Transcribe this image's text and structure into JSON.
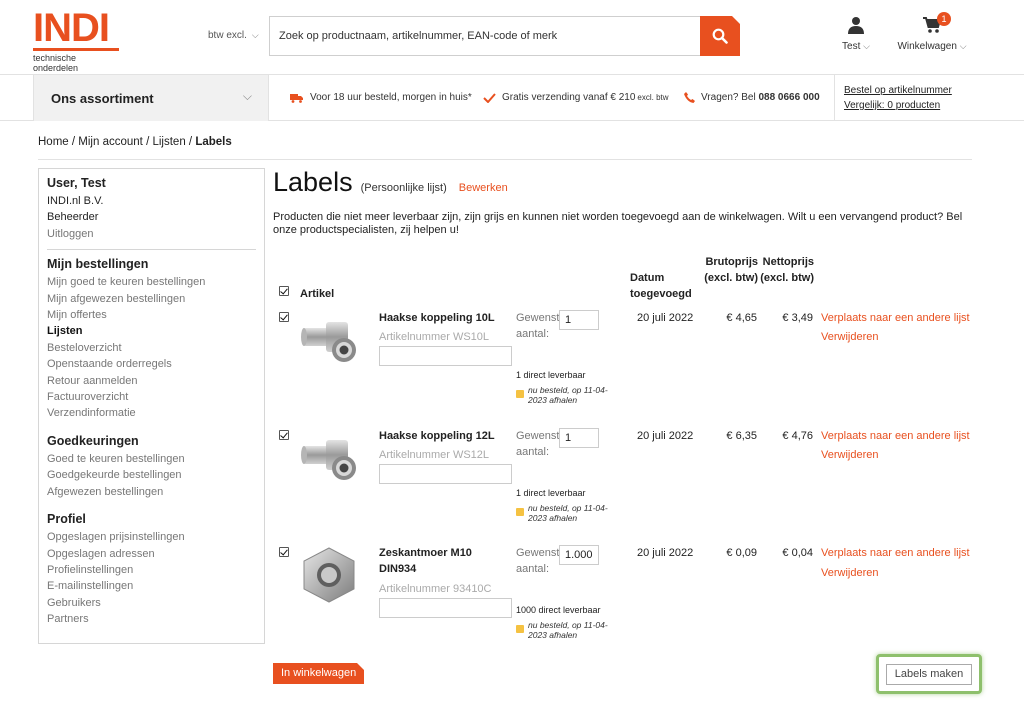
{
  "header": {
    "logo_text": "INDI",
    "logo_sub": "technische onderdelen",
    "btw_label": "btw excl.",
    "search_placeholder": "Zoek op productnaam, artikelnummer, EAN-code of merk",
    "user_label": "Test",
    "cart_label": "Winkelwagen",
    "cart_count": "1"
  },
  "subnav": {
    "assortiment": "Ons assortiment",
    "usp1": "Voor 18 uur besteld, morgen in huis*",
    "usp2": "Gratis verzending vanaf € 210",
    "usp2_small": "excl. btw",
    "usp3": "Vragen? Bel",
    "usp3_phone": "088 0666 000",
    "link1": "Bestel op artikelnummer",
    "link2": "Vergelijk: 0 producten"
  },
  "breadcrumb": {
    "home": "Home",
    "account": "Mijn account",
    "lists": "Lijsten",
    "current": "Labels",
    "sep": "/"
  },
  "sidebar": {
    "user_title": "User, Test",
    "company": "INDI.nl B.V.",
    "role": "Beheerder",
    "logout": "Uitloggen",
    "orders_title": "Mijn bestellingen",
    "orders": [
      "Mijn goed te keuren bestellingen",
      "Mijn afgewezen bestellingen",
      "Mijn offertes",
      "Lijsten",
      "Besteloverzicht",
      "Openstaande orderregels",
      "Retour aanmelden",
      "Factuuroverzicht",
      "Verzendinformatie"
    ],
    "approvals_title": "Goedkeuringen",
    "approvals": [
      "Goed te keuren bestellingen",
      "Goedgekeurde bestellingen",
      "Afgewezen bestellingen"
    ],
    "profile_title": "Profiel",
    "profile": [
      "Opgeslagen prijsinstellingen",
      "Opgeslagen adressen",
      "Profielinstellingen",
      "E-mailinstellingen",
      "Gebruikers",
      "Partners"
    ]
  },
  "main": {
    "title": "Labels",
    "subtitle": "(Persoonlijke lijst)",
    "edit": "Bewerken",
    "notice": "Producten die niet meer leverbaar zijn, zijn grijs en kunnen niet worden toegevoegd aan de winkelwagen. Wilt u een vervangend product? Bel onze productspecialisten, zij helpen u!",
    "col_article": "Artikel",
    "col_date": "Datum toegevoegd",
    "col_bruto": "Brutoprijs (excl. btw)",
    "col_netto": "Nettoprijs (excl. btw)",
    "gewenst": "Gewenst aantal:",
    "move": "Verplaats naar een andere lijst",
    "remove": "Verwijderen",
    "items": [
      {
        "name": "Haakse koppeling 10L",
        "number": "Artikelnummer WS10L",
        "qty": "1",
        "stock": "1 direct leverbaar",
        "pickup": "nu besteld, op 11-04-2023 afhalen",
        "date": "20 juli 2022",
        "bruto": "€ 4,65",
        "netto": "€ 3,49"
      },
      {
        "name": "Haakse koppeling 12L",
        "number": "Artikelnummer WS12L",
        "qty": "1",
        "stock": "1 direct leverbaar",
        "pickup": "nu besteld, op 11-04-2023 afhalen",
        "date": "20 juli 2022",
        "bruto": "€ 6,35",
        "netto": "€ 4,76"
      },
      {
        "name": "Zeskantmoer M10 DIN934",
        "number": "Artikelnummer 93410C",
        "qty": "1.000",
        "stock": "1000 direct leverbaar",
        "pickup": "nu besteld, op 11-04-2023 afhalen",
        "date": "20 juli 2022",
        "bruto": "€ 0,09",
        "netto": "€ 0,04"
      }
    ],
    "cart_button": "In winkelwagen",
    "labels_button": "Labels maken"
  },
  "colors": {
    "accent": "#e8501f",
    "highlight": "#8ec06c"
  }
}
